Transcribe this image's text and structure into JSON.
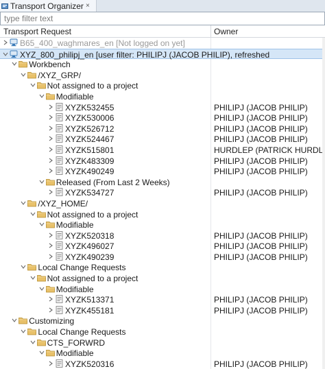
{
  "tab": {
    "title": "Transport Organizer",
    "close": "×"
  },
  "filter": {
    "placeholder": "type filter text",
    "value": ""
  },
  "columns": {
    "request": "Transport Request",
    "owner": "Owner"
  },
  "colors": {
    "folder": "#e8c16a",
    "folder_edge": "#b58b2a",
    "selection": "#d5e6f7",
    "system_icon": "#3a7ab8"
  },
  "rows": [
    {
      "depth": 0,
      "arrow": "right",
      "icon": "system",
      "label": "B65_400_waghmares_en [Not logged on yet]",
      "owner": "",
      "grey": true
    },
    {
      "depth": 0,
      "arrow": "down",
      "icon": "system",
      "label": "XYZ_800_philipj_en [user filter: PHILIPJ (JACOB PHILIP), refreshed",
      "owner": "",
      "selected": true
    },
    {
      "depth": 1,
      "arrow": "down",
      "icon": "folder",
      "label": "Workbench",
      "owner": ""
    },
    {
      "depth": 2,
      "arrow": "down",
      "icon": "folder",
      "label": "/XYZ_GRP/",
      "owner": ""
    },
    {
      "depth": 3,
      "arrow": "down",
      "icon": "folder",
      "label": "Not assigned to a project",
      "owner": ""
    },
    {
      "depth": 4,
      "arrow": "down",
      "icon": "folder",
      "label": "Modifiable",
      "owner": ""
    },
    {
      "depth": 5,
      "arrow": "right",
      "icon": "doc",
      "label": "XYZK532455",
      "owner": "PHILIPJ (JACOB PHILIP)"
    },
    {
      "depth": 5,
      "arrow": "right",
      "icon": "doc",
      "label": "XYZK530006",
      "owner": "PHILIPJ (JACOB PHILIP)"
    },
    {
      "depth": 5,
      "arrow": "right",
      "icon": "doc",
      "label": "XYZK526712",
      "owner": "PHILIPJ (JACOB PHILIP)"
    },
    {
      "depth": 5,
      "arrow": "right",
      "icon": "doc",
      "label": "XYZK524467",
      "owner": "PHILIPJ (JACOB PHILIP)"
    },
    {
      "depth": 5,
      "arrow": "right",
      "icon": "doc",
      "label": "XYZK515801",
      "owner": "HURDLEP (PATRICK HURDLE)"
    },
    {
      "depth": 5,
      "arrow": "right",
      "icon": "doc",
      "label": "XYZK483309",
      "owner": "PHILIPJ (JACOB PHILIP)"
    },
    {
      "depth": 5,
      "arrow": "right",
      "icon": "doc",
      "label": "XYZK490249",
      "owner": "PHILIPJ (JACOB PHILIP)"
    },
    {
      "depth": 4,
      "arrow": "down",
      "icon": "folder",
      "label": "Released (From Last 2 Weeks)",
      "owner": ""
    },
    {
      "depth": 5,
      "arrow": "right",
      "icon": "doc",
      "label": "XYZK534727",
      "owner": "PHILIPJ (JACOB PHILIP)"
    },
    {
      "depth": 2,
      "arrow": "down",
      "icon": "folder",
      "label": "/XYZ_HOME/",
      "owner": ""
    },
    {
      "depth": 3,
      "arrow": "down",
      "icon": "folder",
      "label": "Not assigned to a project",
      "owner": ""
    },
    {
      "depth": 4,
      "arrow": "down",
      "icon": "folder",
      "label": "Modifiable",
      "owner": ""
    },
    {
      "depth": 5,
      "arrow": "right",
      "icon": "doc",
      "label": "XYZK520318",
      "owner": "PHILIPJ (JACOB PHILIP)"
    },
    {
      "depth": 5,
      "arrow": "right",
      "icon": "doc",
      "label": "XYZK496027",
      "owner": "PHILIPJ (JACOB PHILIP)"
    },
    {
      "depth": 5,
      "arrow": "right",
      "icon": "doc",
      "label": "XYZK490239",
      "owner": "PHILIPJ (JACOB PHILIP)"
    },
    {
      "depth": 2,
      "arrow": "down",
      "icon": "folder",
      "label": "Local Change Requests",
      "owner": ""
    },
    {
      "depth": 3,
      "arrow": "down",
      "icon": "folder",
      "label": "Not assigned to a project",
      "owner": ""
    },
    {
      "depth": 4,
      "arrow": "down",
      "icon": "folder",
      "label": "Modifiable",
      "owner": ""
    },
    {
      "depth": 5,
      "arrow": "right",
      "icon": "doc",
      "label": "XYZK513371",
      "owner": "PHILIPJ (JACOB PHILIP)"
    },
    {
      "depth": 5,
      "arrow": "right",
      "icon": "doc",
      "label": "XYZK455181",
      "owner": "PHILIPJ (JACOB PHILIP)"
    },
    {
      "depth": 1,
      "arrow": "down",
      "icon": "folder",
      "label": "Customizing",
      "owner": ""
    },
    {
      "depth": 2,
      "arrow": "down",
      "icon": "folder",
      "label": "Local Change Requests",
      "owner": ""
    },
    {
      "depth": 3,
      "arrow": "down",
      "icon": "folder",
      "label": "CTS_FORWRD",
      "owner": ""
    },
    {
      "depth": 4,
      "arrow": "down",
      "icon": "folder",
      "label": "Modifiable",
      "owner": ""
    },
    {
      "depth": 5,
      "arrow": "right",
      "icon": "doc",
      "label": "XYZK520316",
      "owner": "PHILIPJ (JACOB PHILIP)"
    }
  ]
}
